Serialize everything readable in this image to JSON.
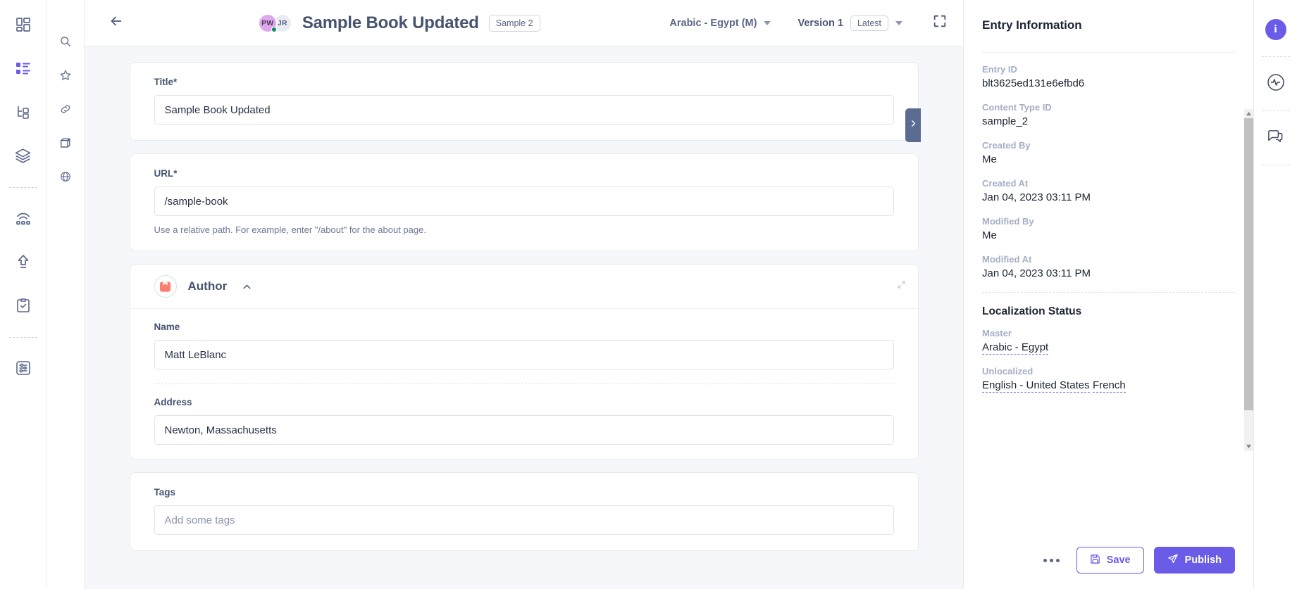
{
  "left_rail": {
    "items": [
      {
        "name": "dashboard-icon",
        "label": "Dashboard"
      },
      {
        "name": "content-types-icon",
        "label": "Content Types"
      },
      {
        "name": "hierarchy-icon",
        "label": "Hierarchy"
      },
      {
        "name": "stack-layers-icon",
        "label": "Stacks"
      },
      {
        "name": "publish-queue-icon",
        "label": "Publish Queue"
      },
      {
        "name": "upload-icon",
        "label": "Upload"
      },
      {
        "name": "tasks-clipboard-icon",
        "label": "Tasks"
      },
      {
        "name": "settings-sliders-icon",
        "label": "Settings"
      }
    ]
  },
  "secondary_rail": {
    "items": [
      {
        "name": "search-icon",
        "label": "Search"
      },
      {
        "name": "star-icon",
        "label": "Favorites"
      },
      {
        "name": "link-icon",
        "label": "References"
      },
      {
        "name": "archive-icon",
        "label": "Archive"
      },
      {
        "name": "location-icon",
        "label": "Locations"
      }
    ]
  },
  "header": {
    "back_label": "Back",
    "avatars": [
      {
        "initials": "PW",
        "online": true
      },
      {
        "initials": "JR",
        "online": false
      }
    ],
    "title": "Sample Book Updated",
    "title_chip": "Sample 2",
    "locale": "Arabic - Egypt (M)",
    "version_label": "Version 1",
    "version_chip": "Latest",
    "expand_label": "Fullscreen"
  },
  "form": {
    "fields": [
      {
        "type": "text",
        "label": "Title*",
        "value": "Sample Book Updated",
        "help": "",
        "name": "title-field"
      },
      {
        "type": "text",
        "label": "URL*",
        "value": "/sample-book",
        "help": "Use a relative path. For example, enter \"/about\" for the about page.",
        "name": "url-field"
      }
    ],
    "group": {
      "title": "Author",
      "collapsed": false,
      "fields": [
        {
          "label": "Name",
          "value": "Matt LeBlanc",
          "name": "author-name-field"
        },
        {
          "label": "Address",
          "value": "Newton, Massachusetts",
          "name": "author-address-field"
        }
      ]
    },
    "tags": {
      "label": "Tags",
      "value": "",
      "placeholder": "Add some tags",
      "name": "tags-field"
    }
  },
  "panel": {
    "title": "Entry Information",
    "meta": [
      {
        "label": "Entry ID",
        "value": "blt3625ed131e6efbd6"
      },
      {
        "label": "Content Type ID",
        "value": "sample_2"
      },
      {
        "label": "Created By",
        "value": "Me"
      },
      {
        "label": "Created At",
        "value": "Jan 04, 2023 03:11 PM"
      },
      {
        "label": "Modified By",
        "value": "Me"
      },
      {
        "label": "Modified At",
        "value": "Jan 04, 2023 03:11 PM"
      }
    ],
    "localization": {
      "title": "Localization Status",
      "master_label": "Master",
      "master_value": "Arabic - Egypt",
      "unlocalized_label": "Unlocalized",
      "unlocalized_values": [
        "English - United States",
        "French"
      ]
    },
    "footer": {
      "more_label": "More options",
      "save_label": "Save",
      "publish_label": "Publish"
    }
  },
  "right_rail": {
    "items": [
      {
        "name": "info-icon",
        "label": "Entry Information",
        "active": true
      },
      {
        "name": "activity-pulse-icon",
        "label": "Activity",
        "active": false
      },
      {
        "name": "comments-icon",
        "label": "Comments",
        "active": false
      }
    ]
  },
  "colors": {
    "accent": "#6b5ce7",
    "canvas": "#f6f7fb",
    "text": "#1d2433",
    "muted": "#a4aec6",
    "panel_tab": "#5b6c93",
    "group_icon": "#fb7d72"
  }
}
